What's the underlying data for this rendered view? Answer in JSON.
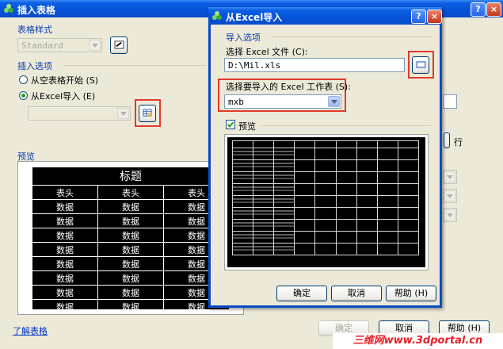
{
  "main_dialog": {
    "title": "插入表格",
    "table_style_label": "表格样式",
    "table_style_value": "Standard",
    "insert_options_label": "插入选项",
    "radio_empty": "从空表格开始",
    "radio_empty_key": "(S)",
    "radio_excel": "从Excel导入",
    "radio_excel_key": "(E)",
    "preview_label": "预览",
    "preview_table": {
      "title": "标题",
      "header": [
        "表头",
        "表头",
        "表头"
      ],
      "rows": [
        [
          "数据",
          "数据",
          "数据"
        ],
        [
          "数据",
          "数据",
          "数据"
        ],
        [
          "数据",
          "数据",
          "数据"
        ],
        [
          "数据",
          "数据",
          "数据"
        ],
        [
          "数据",
          "数据",
          "数据"
        ],
        [
          "数据",
          "数据",
          "数据"
        ],
        [
          "数据",
          "数据",
          "数据"
        ],
        [
          "数据",
          "数据",
          "数据"
        ]
      ]
    },
    "learn_link": "了解表格",
    "ok": "确定",
    "cancel": "取消",
    "help": "帮助",
    "help_key": "(H)",
    "right_hint": "行"
  },
  "excel_dialog": {
    "title": "从Excel导入",
    "import_group": "导入选项",
    "file_label": "选择 Excel 文件",
    "file_key": "(C):",
    "file_value": "D:\\Mil.xls",
    "sheet_label": "选择要导入的 Excel 工作表",
    "sheet_key": "(S):",
    "sheet_value": "mxb",
    "preview_label": "预览",
    "preview_checked": true,
    "ok": "确定",
    "cancel": "取消",
    "help": "帮助",
    "help_key": "(H)"
  },
  "watermark": "三维网www.3dportal.cn",
  "colors": {
    "title_blue": "#0552d8",
    "highlight_red": "#e23a2a",
    "group_blue": "#0a3fb0"
  }
}
